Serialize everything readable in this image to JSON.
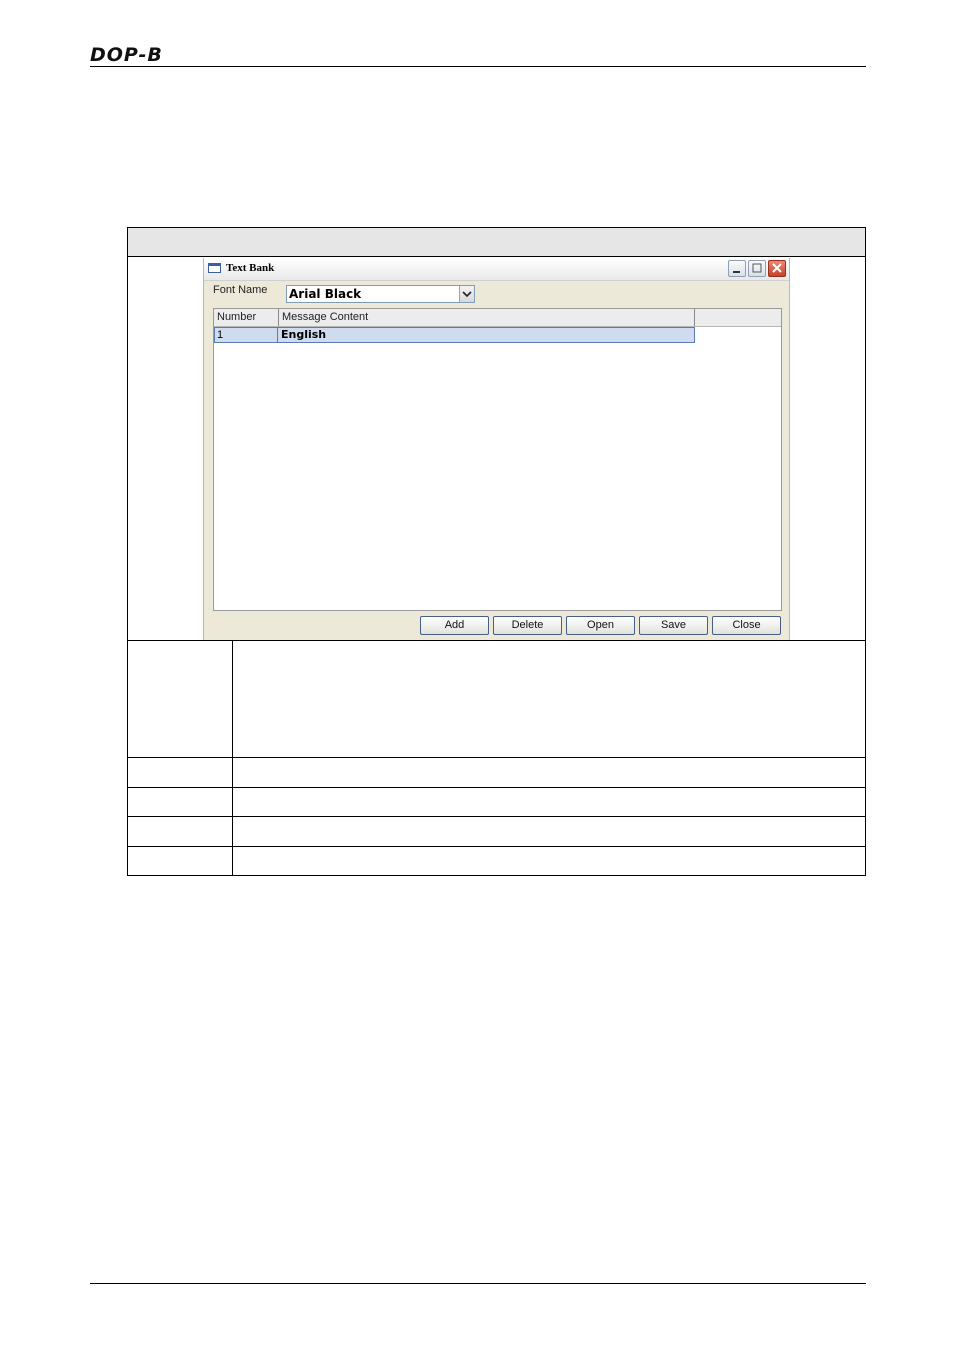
{
  "page_header": {
    "logo_text": "DOP-B"
  },
  "dialog": {
    "title": "Text Bank",
    "font_name_label": "Font Name",
    "font_name_value": "Arial Black",
    "grid": {
      "columns": [
        "Number",
        "Message Content"
      ],
      "rows": [
        {
          "number": "1",
          "message": "English"
        }
      ]
    },
    "buttons": [
      "Add",
      "Delete",
      "Open",
      "Save",
      "Close"
    ]
  }
}
